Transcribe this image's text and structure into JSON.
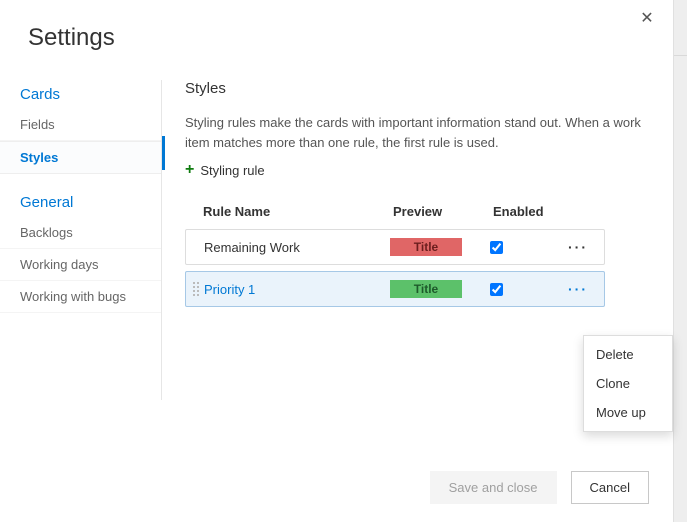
{
  "title": "Settings",
  "sidebar": {
    "group_cards": "Cards",
    "items_cards": [
      "Fields",
      "Styles"
    ],
    "active_cards_index": 1,
    "group_general": "General",
    "items_general": [
      "Backlogs",
      "Working days",
      "Working with bugs"
    ]
  },
  "main": {
    "section_title": "Styles",
    "description": "Styling rules make the cards with important information stand out. When a work item matches more than one rule, the first rule is used.",
    "add_rule_label": "Styling rule",
    "columns": {
      "name": "Rule Name",
      "preview": "Preview",
      "enabled": "Enabled"
    },
    "rows": [
      {
        "name": "Remaining Work",
        "preview_text": "Title",
        "preview_color": "#e06666",
        "enabled": true,
        "selected": false
      },
      {
        "name": "Priority 1",
        "preview_text": "Title",
        "preview_color": "#5cc16a",
        "enabled": true,
        "selected": true
      }
    ]
  },
  "context_menu": {
    "items": [
      "Delete",
      "Clone",
      "Move up"
    ]
  },
  "footer": {
    "save": "Save and close",
    "cancel": "Cancel"
  }
}
